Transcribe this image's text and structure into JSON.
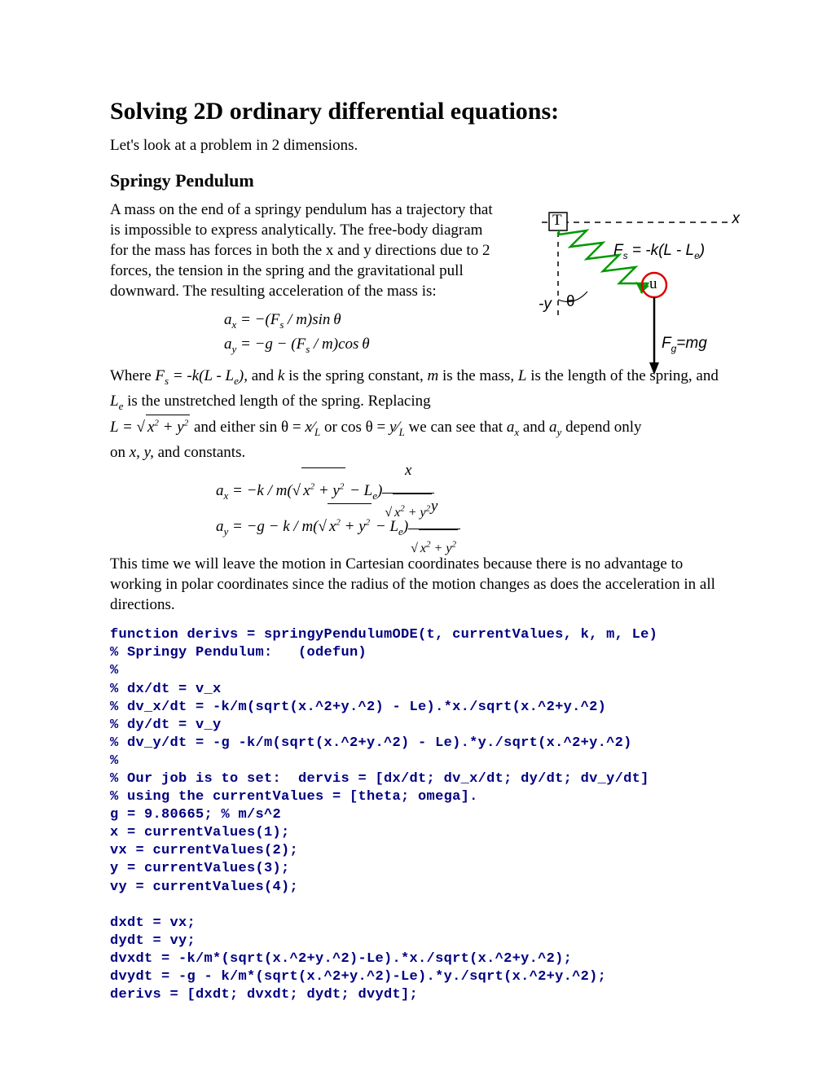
{
  "title": "Solving 2D ordinary differential equations:",
  "intro": "Let's look at a problem in 2 dimensions.",
  "subheading": "Springy Pendulum",
  "para1": "A mass on the end of a springy pendulum has a trajectory that is impossible to express analytically.  The free-body diagram for the mass has forces in both the x and y directions due to 2 forces, the tension in the spring and the gravitational pull downward.  The resulting acceleration of the mass is:",
  "eq_simple": {
    "ax": "aₓ = −(Fₛ / m) sin θ",
    "ay": "a_y = −g − (Fₛ / m) cos θ"
  },
  "para2_parts": {
    "a": "Where ",
    "fs_eq": "Fₛ = -k(L - L_e),",
    "b": " and ",
    "k": "k",
    "c": " is the spring constant, ",
    "m": "m",
    "d": " is the mass, ",
    "L": "L",
    "e": " is the length of the spring, and ",
    "Le": "L_e",
    "f": " is the unstretched length of the spring.  Replacing "
  },
  "para2b_parts": {
    "sqrt_expr": "x² + y²",
    "mid1": " and either sin θ = ",
    "ratio_x": "x⁄L",
    "mid2": " or  cos θ = ",
    "ratio_y": "y⁄L",
    "mid3": "  we can see that  ",
    "ax": "aₓ",
    "and": " and  ",
    "ay": "a_y",
    "end": "  depend only"
  },
  "para2c": "on x, y, and constants.",
  "eq_full": {
    "ax_lhs": "aₓ = −k / m(",
    "sqrt": "x² + y²",
    "minusLe": " − L_e)",
    "frac_num_x": "x",
    "frac_den": "√(x² + y²)",
    "ay_lhs": "a_y = −g − k / m(",
    "frac_num_y": "y"
  },
  "para3": "This time we will leave the motion in Cartesian coordinates because there is no advantage to working in polar coordinates since the radius of the motion changes as does the acceleration in all directions.",
  "code": "function derivs = springyPendulumODE(t, currentValues, k, m, Le)\n% Springy Pendulum:   (odefun)\n%\n% dx/dt = v_x\n% dv_x/dt = -k/m(sqrt(x.^2+y.^2) - Le).*x./sqrt(x.^2+y.^2)\n% dy/dt = v_y\n% dv_y/dt = -g -k/m(sqrt(x.^2+y.^2) - Le).*y./sqrt(x.^2+y.^2)\n%\n% Our job is to set:  dervis = [dx/dt; dv_x/dt; dy/dt; dv_y/dt]\n% using the currentValues = [theta; omega].\ng = 9.80665; % m/s^2\nx = currentValues(1);\nvx = currentValues(2);\ny = currentValues(3);\nvy = currentValues(4);\n\ndxdt = vx;\ndydt = vy;\ndvxdt = -k/m*(sqrt(x.^2+y.^2)-Le).*x./sqrt(x.^2+y.^2);\ndvydt = -g - k/m*(sqrt(x.^2+y.^2)-Le).*y./sqrt(x.^2+y.^2);\nderivs = [dxdt; dvxdt; dydt; dvydt];",
  "figure": {
    "x_label": "x",
    "y_label": "-y",
    "theta": "θ",
    "fs": "Fₛ = -k(L - L_e)",
    "fg": "F_g=mg",
    "pivot": "T",
    "mass": "u"
  }
}
